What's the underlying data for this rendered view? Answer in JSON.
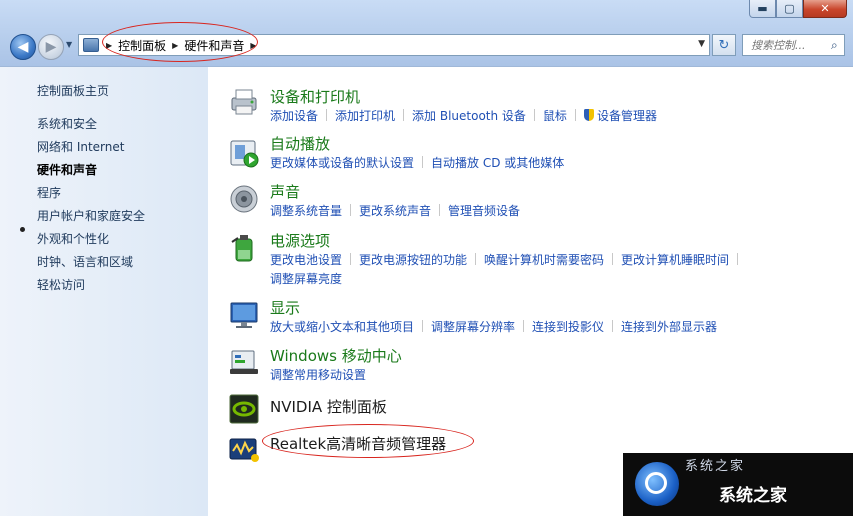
{
  "window": {
    "min_label": "▬",
    "max_label": "▢",
    "close_label": "✕"
  },
  "nav": {
    "breadcrumb": [
      "控制面板",
      "硬件和声音"
    ],
    "search_placeholder": "搜索控制..."
  },
  "sidebar": {
    "items": [
      {
        "label": "控制面板主页"
      },
      {
        "label": "系统和安全"
      },
      {
        "label": "网络和 Internet"
      },
      {
        "label": "硬件和声音"
      },
      {
        "label": "程序"
      },
      {
        "label": "用户帐户和家庭安全"
      },
      {
        "label": "外观和个性化"
      },
      {
        "label": "时钟、语言和区域"
      },
      {
        "label": "轻松访问"
      }
    ]
  },
  "categories": [
    {
      "title": "设备和打印机",
      "links": [
        "添加设备",
        "添加打印机",
        "添加 Bluetooth 设备",
        "鼠标",
        "设备管理器"
      ]
    },
    {
      "title": "自动播放",
      "links": [
        "更改媒体或设备的默认设置",
        "自动播放 CD 或其他媒体"
      ]
    },
    {
      "title": "声音",
      "links": [
        "调整系统音量",
        "更改系统声音",
        "管理音频设备"
      ]
    },
    {
      "title": "电源选项",
      "links": [
        "更改电池设置",
        "更改电源按钮的功能",
        "唤醒计算机时需要密码",
        "更改计算机睡眠时间",
        "调整屏幕亮度"
      ]
    },
    {
      "title": "显示",
      "links": [
        "放大或缩小文本和其他项目",
        "调整屏幕分辨率",
        "连接到投影仪",
        "连接到外部显示器"
      ]
    },
    {
      "title": "Windows 移动中心",
      "links": [
        "调整常用移动设置"
      ]
    },
    {
      "title": "NVIDIA 控制面板",
      "links": []
    },
    {
      "title": "Realtek高清晰音频管理器",
      "links": []
    }
  ],
  "watermark": {
    "name": "系统之家"
  },
  "colors": {
    "category_title": "#1a7a1a",
    "link": "#1f4fb4",
    "annotation": "#d8261f"
  }
}
